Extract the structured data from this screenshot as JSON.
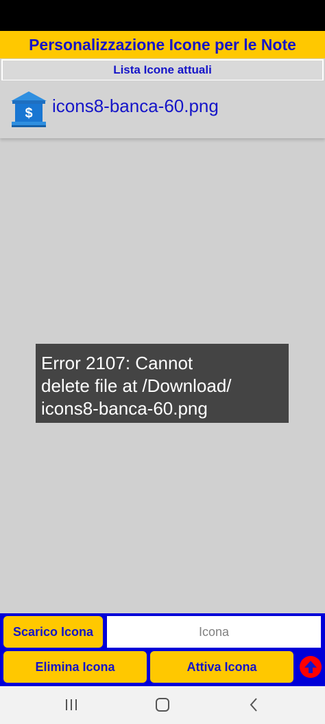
{
  "header": {
    "title": "Personalizzazione Icone per le Note",
    "subtitle": "Lista Icone attuali"
  },
  "icon_list": [
    {
      "label": "icons8-banca-60.png",
      "icon": "bank-icon"
    }
  ],
  "toast": {
    "lines": [
      "Error 2107: Cannot",
      "delete file at /Download/",
      "icons8-banca-60.png"
    ]
  },
  "bottom": {
    "download_label": "Scarico Icona",
    "icon_field_placeholder": "Icona",
    "delete_label": "Elimina Icona",
    "activate_label": "Attiva Icona",
    "up_icon": "arrow-up-icon"
  },
  "nav": {
    "recents_icon": "recents-icon",
    "home_icon": "home-icon",
    "back_icon": "back-icon"
  },
  "colors": {
    "accent_yellow": "#ffc800",
    "text_blue": "#1515c8",
    "panel_blue": "#0000d8",
    "up_red": "#ff0000"
  }
}
